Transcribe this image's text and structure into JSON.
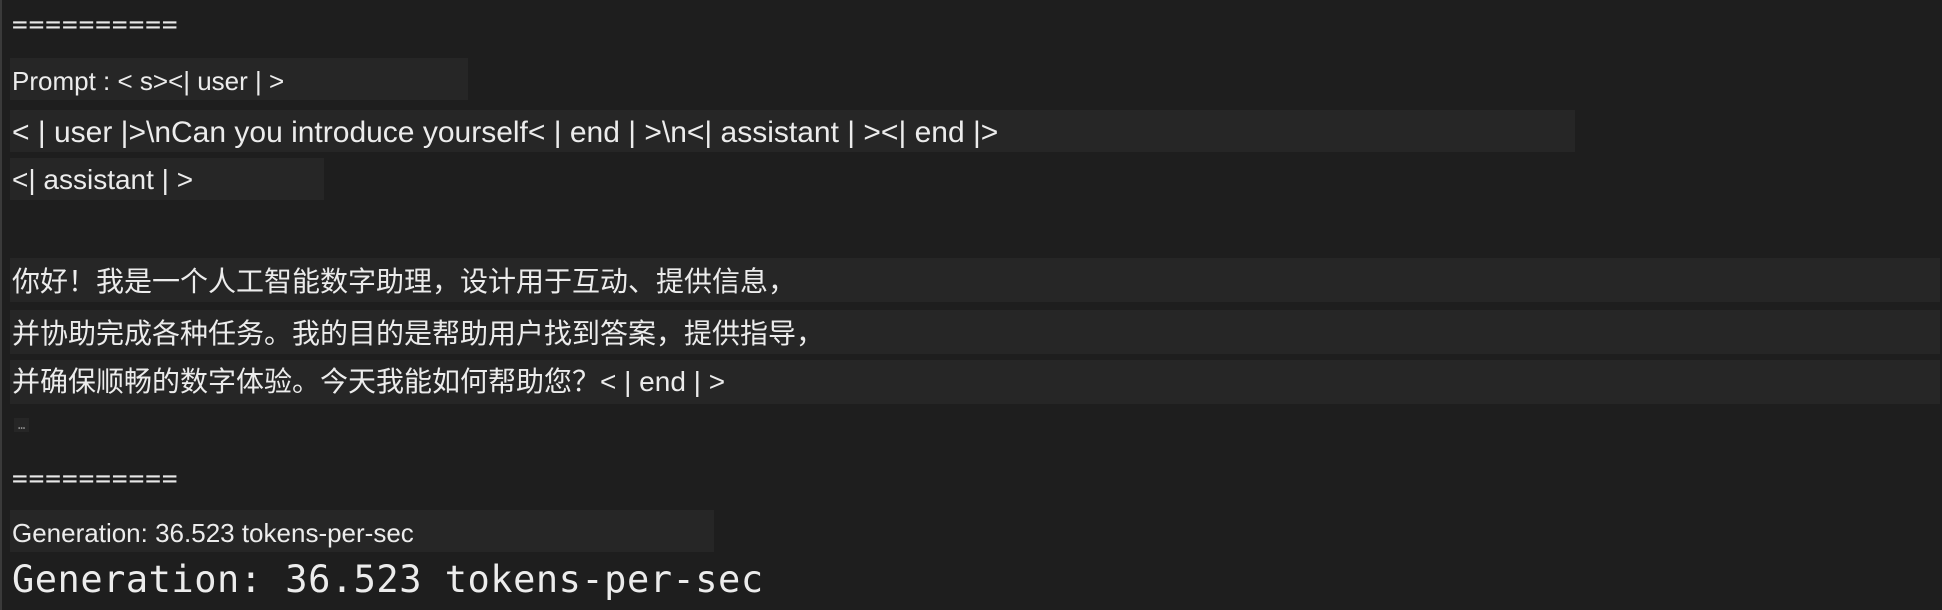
{
  "separator_top": "==========",
  "prompt": {
    "line1": "Prompt : < s><| user | >",
    "line2": "< | user |>\\nCan you introduce yourself< | end | >\\n<| assistant | ><| end |>",
    "line3": "<| assistant | >"
  },
  "response": {
    "line1": "你好！我是一个人工智能数字助理，设计用于互动、提供信息，",
    "line2": "并协助完成各种任务。我的目的是帮助用户找到答案，提供指导，",
    "line3": "并确保顺畅的数字体验。今天我能如何帮助您？< | end | >"
  },
  "ellipsis": "…",
  "separator_bottom": "==========",
  "generation_small": "Generation: 36.523 tokens-per-sec",
  "generation_large": "Generation: 36.523 tokens-per-sec"
}
